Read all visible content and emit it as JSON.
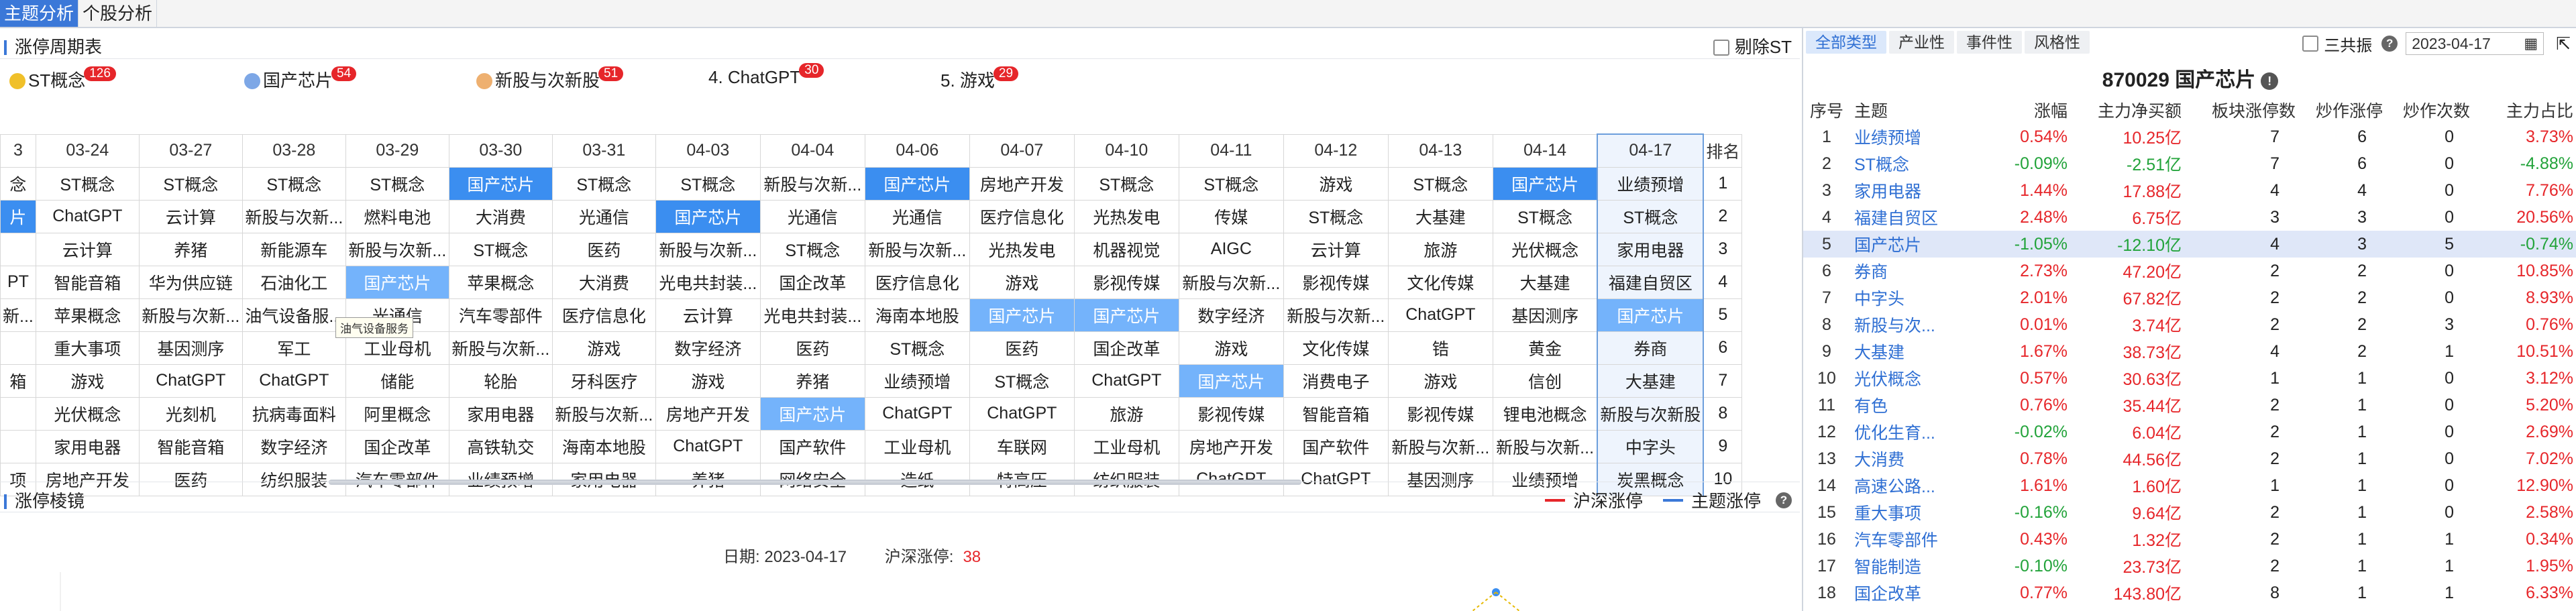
{
  "top_tabs": [
    {
      "label": "主题分析",
      "active": true
    },
    {
      "label": "个股分析",
      "active": false
    }
  ],
  "cycle": {
    "title": "涨停周期表",
    "exclude_st": "剔除ST",
    "legend": [
      {
        "label": "ST概念",
        "count": "126",
        "dot": "#f0c02a"
      },
      {
        "label": "国产芯片",
        "count": "54",
        "dot": "#7da7e6"
      },
      {
        "label": "新股与次新股",
        "count": "51",
        "dot": "#eeb070"
      },
      {
        "label": "4. ChatGPT",
        "count": "30",
        "dot": ""
      },
      {
        "label": "5. 游戏",
        "count": "29",
        "dot": ""
      }
    ],
    "rank_header": "排名",
    "dates": [
      "3",
      "03-24",
      "03-27",
      "03-28",
      "03-29",
      "03-30",
      "03-31",
      "04-03",
      "04-04",
      "04-06",
      "04-07",
      "04-10",
      "04-11",
      "04-12",
      "04-13",
      "04-14",
      "04-17"
    ],
    "rows": [
      {
        "rank": "1",
        "cells": [
          "念",
          "ST概念",
          "ST概念",
          "ST概念",
          "ST概念",
          "国产芯片",
          "ST概念",
          "ST概念",
          "新股与次新...",
          "国产芯片",
          "房地产开发",
          "ST概念",
          "ST概念",
          "游戏",
          "ST概念",
          "国产芯片",
          "业绩预增"
        ],
        "hl": [
          5,
          9,
          15
        ]
      },
      {
        "rank": "2",
        "cells": [
          "片",
          "ChatGPT",
          "云计算",
          "新股与次新...",
          "燃料电池",
          "大消费",
          "光通信",
          "国产芯片",
          "光通信",
          "光通信",
          "医疗信息化",
          "光热发电",
          "传媒",
          "ST概念",
          "大基建",
          "ST概念",
          "ST概念"
        ],
        "hl": [
          0,
          7
        ]
      },
      {
        "rank": "3",
        "cells": [
          "",
          "云计算",
          "养猪",
          "新能源车",
          "新股与次新...",
          "ST概念",
          "医药",
          "新股与次新...",
          "ST概念",
          "新股与次新...",
          "光热发电",
          "机器视觉",
          "AIGC",
          "云计算",
          "旅游",
          "光伏概念",
          "家用电器"
        ],
        "hl": []
      },
      {
        "rank": "4",
        "cells": [
          "PT",
          "智能音箱",
          "华为供应链",
          "石油化工",
          "国产芯片",
          "苹果概念",
          "大消费",
          "光电共封装...",
          "国企改革",
          "医疗信息化",
          "游戏",
          "影视传媒",
          "新股与次新...",
          "影视传媒",
          "文化传媒",
          "大基建",
          "福建自贸区"
        ],
        "hl": [],
        "hl2": [
          4
        ]
      },
      {
        "rank": "5",
        "cells": [
          "新...",
          "苹果概念",
          "新股与次新...",
          "油气设备服...",
          "光通信",
          "汽车零部件",
          "医疗信息化",
          "云计算",
          "光电共封装...",
          "海南本地股",
          "国产芯片",
          "国产芯片",
          "数字经济",
          "新股与次新...",
          "ChatGPT",
          "基因测序",
          "国产芯片"
        ],
        "hl": [],
        "hl2": [
          10,
          11,
          16
        ]
      },
      {
        "rank": "6",
        "cells": [
          "",
          "重大事项",
          "基因测序",
          "军工",
          "工业母机",
          "新股与次新...",
          "游戏",
          "数字经济",
          "医药",
          "ST概念",
          "医药",
          "国企改革",
          "游戏",
          "文化传媒",
          "锆",
          "黄金",
          "券商"
        ],
        "hl": []
      },
      {
        "rank": "7",
        "cells": [
          "箱",
          "游戏",
          "ChatGPT",
          "ChatGPT",
          "储能",
          "轮胎",
          "牙科医疗",
          "游戏",
          "养猪",
          "业绩预增",
          "ST概念",
          "ChatGPT",
          "国产芯片",
          "消费电子",
          "游戏",
          "信创",
          "大基建"
        ],
        "hl": [],
        "hl2": [
          12
        ]
      },
      {
        "rank": "8",
        "cells": [
          "",
          "光伏概念",
          "光刻机",
          "抗病毒面料",
          "阿里概念",
          "家用电器",
          "新股与次新...",
          "房地产开发",
          "国产芯片",
          "ChatGPT",
          "ChatGPT",
          "旅游",
          "影视传媒",
          "智能音箱",
          "影视传媒",
          "锂电池概念",
          "新股与次新股"
        ],
        "hl": [],
        "hl2": [
          8
        ]
      },
      {
        "rank": "9",
        "cells": [
          "",
          "家用电器",
          "智能音箱",
          "数字经济",
          "国企改革",
          "高铁轨交",
          "海南本地股",
          "ChatGPT",
          "国产软件",
          "工业母机",
          "车联网",
          "工业母机",
          "房地产开发",
          "国产软件",
          "新股与次新...",
          "新股与次新...",
          "中字头"
        ],
        "hl": []
      },
      {
        "rank": "10",
        "cells": [
          "项",
          "房地产开发",
          "医药",
          "纺织服装",
          "汽车零部件",
          "业绩预增",
          "家用电器",
          "养猪",
          "网络安全",
          "造纸",
          "特高压",
          "纺织服装",
          "ChatGPT",
          "ChatGPT",
          "基因测序",
          "业绩预增",
          "炭黑概念"
        ],
        "hl": []
      }
    ],
    "tooltip": "油气设备服务"
  },
  "limit": {
    "title": "涨停棱镜",
    "legend": [
      {
        "label": "沪深涨停",
        "color": "#e6262a"
      },
      {
        "label": "主题涨停",
        "color": "#3b78d8"
      }
    ],
    "date_label": "日期:",
    "date_value": "2023-04-17",
    "count_label": "沪深涨停:",
    "count_value": "38"
  },
  "right": {
    "tabs": [
      {
        "label": "全部类型",
        "active": true
      },
      {
        "label": "产业性",
        "active": false
      },
      {
        "label": "事件性",
        "active": false
      },
      {
        "label": "风格性",
        "active": false
      }
    ],
    "resonance": "三共振",
    "date": "2023-04-17",
    "stock_title": "870029 国产芯片",
    "columns": [
      "序号",
      "主题",
      "涨幅",
      "主力净买额",
      "板块涨停数",
      "炒作涨停",
      "炒作次数",
      "主力占比"
    ],
    "rows": [
      {
        "seq": "1",
        "name": "业绩预增",
        "pct": "0.54%",
        "net": "10.25亿",
        "lim": "7",
        "hype": "6",
        "times": "0",
        "ratio": "3.73%",
        "pct_up": true,
        "net_up": true,
        "ratio_up": true
      },
      {
        "seq": "2",
        "name": "ST概念",
        "pct": "-0.09%",
        "net": "-2.51亿",
        "lim": "7",
        "hype": "6",
        "times": "0",
        "ratio": "-4.88%",
        "pct_up": false,
        "net_up": false,
        "ratio_up": false
      },
      {
        "seq": "3",
        "name": "家用电器",
        "pct": "1.44%",
        "net": "17.88亿",
        "lim": "4",
        "hype": "4",
        "times": "0",
        "ratio": "7.76%",
        "pct_up": true,
        "net_up": true,
        "ratio_up": true
      },
      {
        "seq": "4",
        "name": "福建自贸区",
        "pct": "2.48%",
        "net": "6.75亿",
        "lim": "3",
        "hype": "3",
        "times": "0",
        "ratio": "20.56%",
        "pct_up": true,
        "net_up": true,
        "ratio_up": true
      },
      {
        "seq": "5",
        "name": "国产芯片",
        "pct": "-1.05%",
        "net": "-12.10亿",
        "lim": "4",
        "hype": "3",
        "times": "5",
        "ratio": "-0.74%",
        "pct_up": false,
        "net_up": false,
        "ratio_up": false,
        "selected": true
      },
      {
        "seq": "6",
        "name": "券商",
        "pct": "2.73%",
        "net": "47.20亿",
        "lim": "2",
        "hype": "2",
        "times": "0",
        "ratio": "10.85%",
        "pct_up": true,
        "net_up": true,
        "ratio_up": true
      },
      {
        "seq": "7",
        "name": "中字头",
        "pct": "2.01%",
        "net": "67.82亿",
        "lim": "2",
        "hype": "2",
        "times": "0",
        "ratio": "8.93%",
        "pct_up": true,
        "net_up": true,
        "ratio_up": true
      },
      {
        "seq": "8",
        "name": "新股与次...",
        "pct": "0.01%",
        "net": "3.74亿",
        "lim": "2",
        "hype": "2",
        "times": "3",
        "ratio": "0.76%",
        "pct_up": true,
        "net_up": true,
        "ratio_up": true
      },
      {
        "seq": "9",
        "name": "大基建",
        "pct": "1.67%",
        "net": "38.73亿",
        "lim": "4",
        "hype": "2",
        "times": "1",
        "ratio": "10.51%",
        "pct_up": true,
        "net_up": true,
        "ratio_up": true
      },
      {
        "seq": "10",
        "name": "光伏概念",
        "pct": "0.57%",
        "net": "30.63亿",
        "lim": "1",
        "hype": "1",
        "times": "0",
        "ratio": "3.12%",
        "pct_up": true,
        "net_up": true,
        "ratio_up": true
      },
      {
        "seq": "11",
        "name": "有色",
        "pct": "0.76%",
        "net": "35.44亿",
        "lim": "2",
        "hype": "1",
        "times": "0",
        "ratio": "5.20%",
        "pct_up": true,
        "net_up": true,
        "ratio_up": true
      },
      {
        "seq": "12",
        "name": "优化生育...",
        "pct": "-0.02%",
        "net": "6.04亿",
        "lim": "2",
        "hype": "1",
        "times": "0",
        "ratio": "2.69%",
        "pct_up": false,
        "net_up": true,
        "ratio_up": true
      },
      {
        "seq": "13",
        "name": "大消费",
        "pct": "0.78%",
        "net": "44.56亿",
        "lim": "2",
        "hype": "1",
        "times": "0",
        "ratio": "7.02%",
        "pct_up": true,
        "net_up": true,
        "ratio_up": true
      },
      {
        "seq": "14",
        "name": "高速公路...",
        "pct": "1.61%",
        "net": "1.60亿",
        "lim": "1",
        "hype": "1",
        "times": "0",
        "ratio": "12.90%",
        "pct_up": true,
        "net_up": true,
        "ratio_up": true
      },
      {
        "seq": "15",
        "name": "重大事项",
        "pct": "-0.16%",
        "net": "9.64亿",
        "lim": "2",
        "hype": "1",
        "times": "0",
        "ratio": "2.58%",
        "pct_up": false,
        "net_up": true,
        "ratio_up": true
      },
      {
        "seq": "16",
        "name": "汽车零部件",
        "pct": "0.43%",
        "net": "1.32亿",
        "lim": "2",
        "hype": "1",
        "times": "1",
        "ratio": "0.34%",
        "pct_up": true,
        "net_up": true,
        "ratio_up": true
      },
      {
        "seq": "17",
        "name": "智能制造",
        "pct": "-0.10%",
        "net": "23.73亿",
        "lim": "2",
        "hype": "1",
        "times": "1",
        "ratio": "1.95%",
        "pct_up": false,
        "net_up": true,
        "ratio_up": true
      },
      {
        "seq": "18",
        "name": "国企改革",
        "pct": "0.77%",
        "net": "143.80亿",
        "lim": "8",
        "hype": "1",
        "times": "1",
        "ratio": "6.33%",
        "pct_up": true,
        "net_up": true,
        "ratio_up": true
      }
    ]
  }
}
